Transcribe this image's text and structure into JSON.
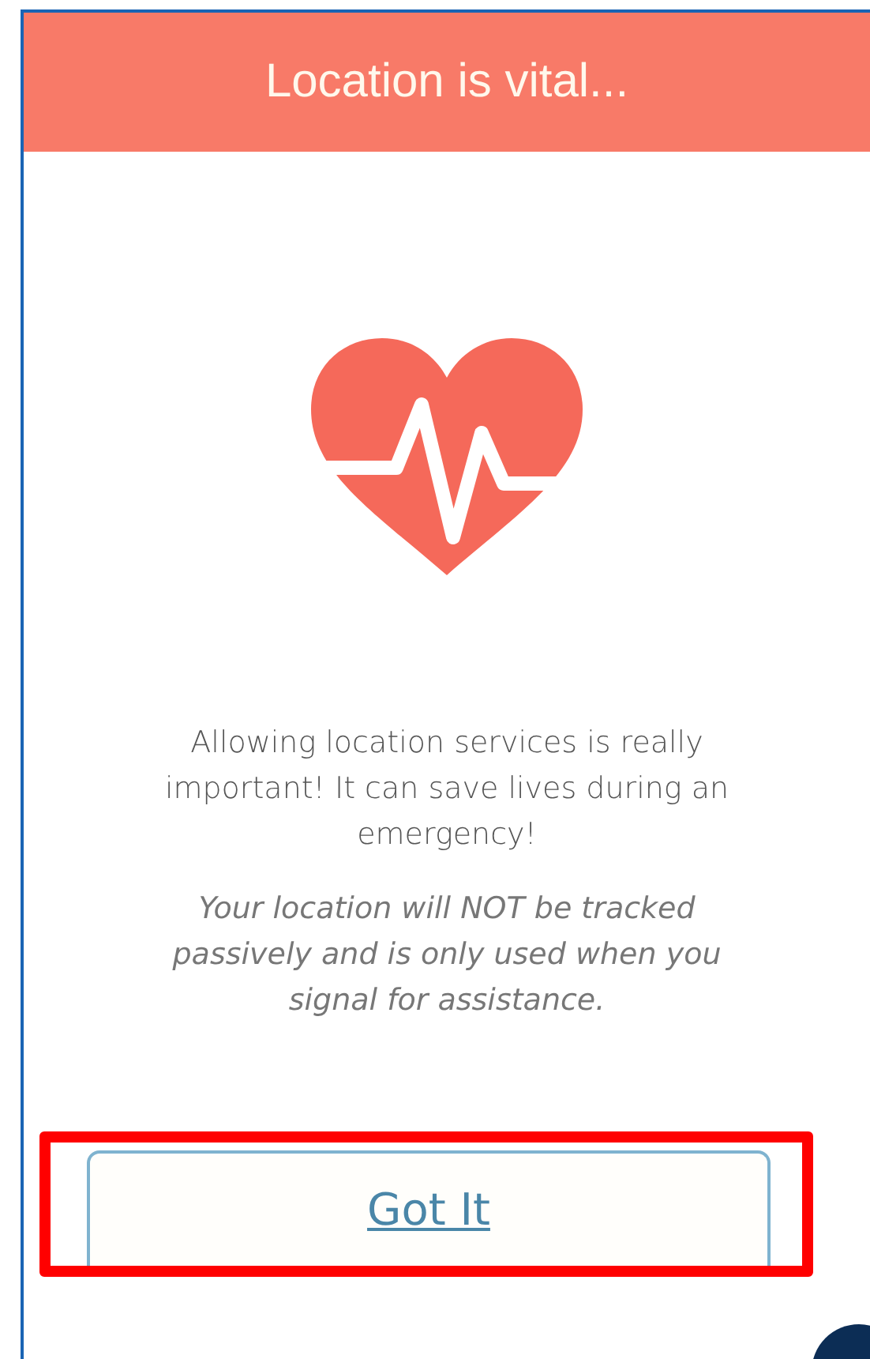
{
  "header": {
    "title": "Location is vital..."
  },
  "message": {
    "text": "Allowing location services is really important! It can save lives during an emergency!",
    "note": "Your location will NOT be tracked passively and is only used when you signal for assistance."
  },
  "button": {
    "label": "Got It",
    "highlighted": true
  }
}
